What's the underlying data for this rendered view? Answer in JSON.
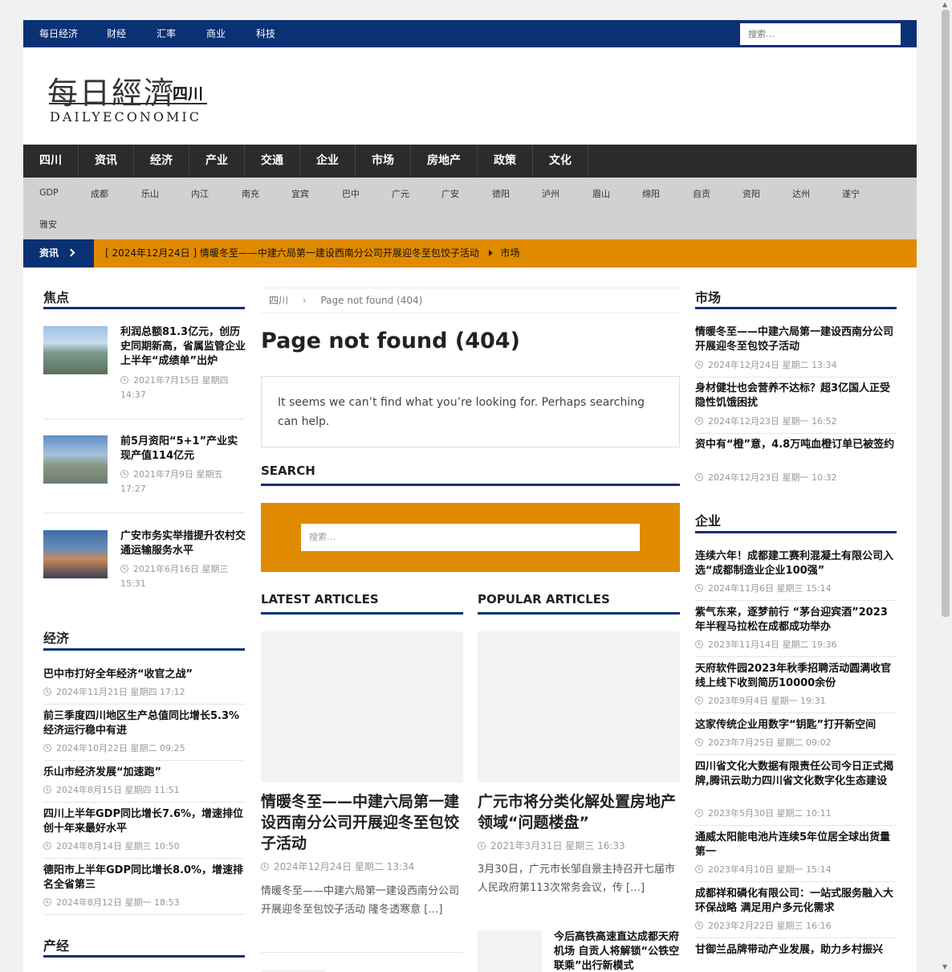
{
  "topnav": {
    "items": [
      "每日经济",
      "财经",
      "汇率",
      "商业",
      "科技"
    ],
    "search_placeholder": "搜索…"
  },
  "logo": {
    "cn": "每日經濟",
    "region": "四川",
    "en": "DAILYECONOMIC"
  },
  "mainnav": [
    "四川",
    "资讯",
    "经济",
    "产业",
    "交通",
    "企业",
    "市场",
    "房地产",
    "政策",
    "文化"
  ],
  "subnav": [
    "GDP",
    "成都",
    "乐山",
    "内江",
    "南充",
    "宜宾",
    "巴中",
    "广元",
    "广安",
    "德阳",
    "泸州",
    "眉山",
    "绵阳",
    "自贡",
    "资阳",
    "达州",
    "遂宁",
    "雅安"
  ],
  "ticker": {
    "label": "资讯",
    "text": "[ 2024年12月24日 ]  情暖冬至——中建六局第一建设西南分公司开展迎冬至包饺子活动",
    "category": "市场"
  },
  "left": {
    "focus": {
      "heading": "焦点",
      "items": [
        {
          "title": "利润总额81.3亿元，创历史同期新高，省属监管企业上半年“成绩单”出炉",
          "date1": "2021年7月15日 星期四",
          "date2": "14:37"
        },
        {
          "title": "前5月资阳“5+1”产业实现产值114亿元",
          "date1": "2021年7月9日 星期五",
          "date2": "17:27"
        },
        {
          "title": "广安市务实举措提升农村交通运输服务水平",
          "date1": "2021年6月16日 星期三",
          "date2": "15:31"
        }
      ]
    },
    "economy": {
      "heading": "经济",
      "items": [
        {
          "title": "巴中市打好全年经济“收官之战”",
          "date": "2024年11月21日 星期四 17:12"
        },
        {
          "title": "前三季度四川地区生产总值同比增长5.3% 经济运行稳中有进",
          "date": "2024年10月22日 星期二 09:25"
        },
        {
          "title": "乐山市经济发展“加速跑”",
          "date": "2024年8月15日 星期四 11:51"
        },
        {
          "title": "四川上半年GDP同比增长7.6%，增速排位创十年来最好水平",
          "date": "2024年8月14日 星期三 10:50"
        },
        {
          "title": "德阳市上半年GDP同比增长8.0%，增速排名全省第三",
          "date": "2024年8月12日 星期一 18:53"
        }
      ]
    },
    "industry": {
      "heading": "产经"
    }
  },
  "center": {
    "breadcrumb": {
      "home": "四川",
      "current": "Page not found (404)"
    },
    "page_title": "Page not found (404)",
    "message": "It seems we can’t find what you’re looking for. Perhaps searching can help.",
    "search_heading": "SEARCH",
    "search_placeholder": "搜索…",
    "latest": {
      "heading": "LATEST ARTICLES",
      "title": "情暖冬至——中建六局第一建设西南分公司开展迎冬至包饺子活动",
      "date": "2024年12月24日 星期二 13:34",
      "excerpt": "情暖冬至——中建六局第一建设西南分公司开展迎冬至包饺子活动 隆冬透寒意 […]"
    },
    "popular": {
      "heading": "POPULAR ARTICLES",
      "title": "广元市将分类化解处置房地产领域“问题楼盘”",
      "date": "2021年3月31日 星期三 16:33",
      "excerpt": "3月30日，广元市长邹自景主持召开七届市人民政府第113次常务会议，传 […]",
      "next_title": "今后高铁高速直达成都天府机场 自贡人将解锁“公铁空联乘”出行新模式"
    }
  },
  "right": {
    "market": {
      "heading": "市场",
      "items": [
        {
          "title": "情暖冬至——中建六局第一建设西南分公司开展迎冬至包饺子活动",
          "date": "2024年12月24日 星期二 13:34"
        },
        {
          "title": "身材健壮也会营养不达标？超3亿国人正受隐性饥饿困扰",
          "date": "2024年12月23日 星期一 16:52"
        },
        {
          "title": "资中有“橙”意，4.8万吨血橙订单已被签约",
          "date": "2024年12月23日 星期一 10:32"
        }
      ]
    },
    "enterprise": {
      "heading": "企业",
      "items": [
        {
          "title": "连续六年！成都建工赛利混凝土有限公司入选“成都制造业企业100强”",
          "date": "2024年11月6日 星期三 15:14"
        },
        {
          "title": "紫气东来，逐梦前行 “茅台迎宾酒”2023年半程马拉松在成都成功举办",
          "date": "2023年11月14日 星期二 19:36"
        },
        {
          "title": "天府软件园2023年秋季招聘活动圆满收官 线上线下收到简历10000余份",
          "date": "2023年9月4日 星期一 19:31"
        },
        {
          "title": "这家传统企业用数字“钥匙”打开新空间",
          "date": "2023年7月25日 星期二 09:02"
        },
        {
          "title": "四川省文化大数据有限责任公司今日正式揭牌,腾讯云助力四川省文化数字化生态建设",
          "date": "2023年5月30日 星期二 10:11"
        },
        {
          "title": "通威太阳能电池片连续5年位居全球出货量第一",
          "date": "2023年4月10日 星期一 15:14"
        },
        {
          "title": "成都祥和磷化有限公司：一站式服务融入大环保战略 满足用户多元化需求",
          "date": "2023年2月22日 星期三 16:16"
        },
        {
          "title": "甘御兰品牌带动产业发展，助力乡村振兴",
          "date": ""
        }
      ]
    }
  },
  "colors": {
    "navy": "#0a3174",
    "orange": "#e08a00",
    "dark_nav": "#2b2b2b",
    "sub_nav": "#d1d1d1"
  }
}
